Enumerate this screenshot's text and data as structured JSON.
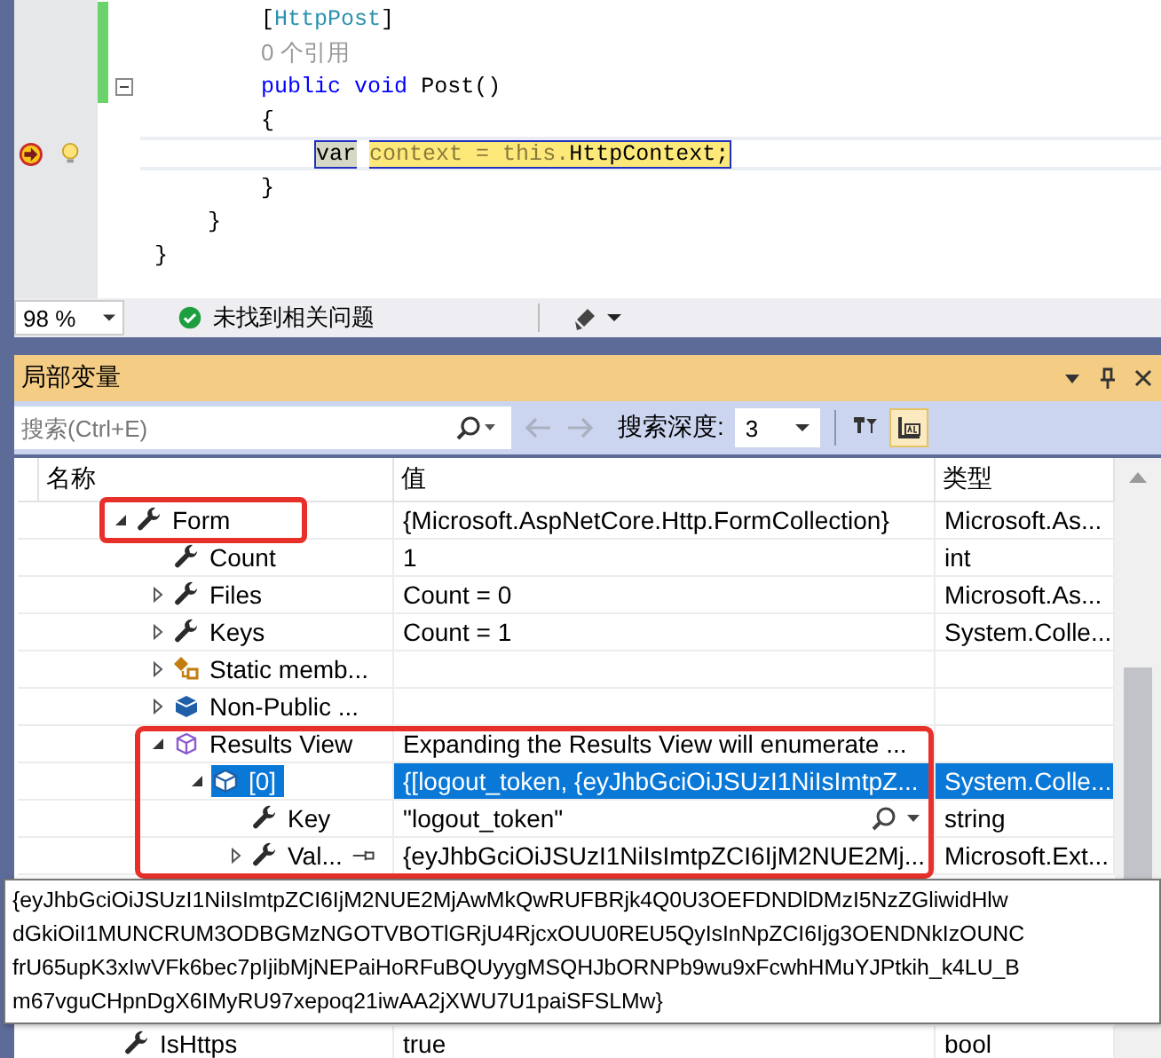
{
  "editor": {
    "lines": [
      {
        "kind": "code",
        "changed": true,
        "tokens": [
          {
            "text": "        [",
            "kind": "plain"
          },
          {
            "text": "HttpPost",
            "kind": "type"
          },
          {
            "text": "]",
            "kind": "plain"
          }
        ]
      },
      {
        "kind": "codelens",
        "changed": true,
        "text": "0 个引用"
      },
      {
        "kind": "code",
        "changed": true,
        "folded": false,
        "tokens": [
          {
            "text": "        public",
            "kind": "keyword"
          },
          {
            "text": " void",
            "kind": "keyword"
          },
          {
            "text": " Post()",
            "kind": "plain"
          }
        ]
      },
      {
        "kind": "code",
        "changed": false,
        "tokens": [
          {
            "text": "        {",
            "kind": "plain"
          }
        ]
      },
      {
        "kind": "code",
        "changed": false,
        "current": true,
        "lightbulb": true,
        "tokens": [
          {
            "text": "            var",
            "kind": "ref"
          },
          {
            "text": " context = this.",
            "kind": "faded"
          },
          {
            "text": "HttpContext;",
            "kind": "plain"
          }
        ]
      },
      {
        "kind": "code",
        "changed": false,
        "tokens": [
          {
            "text": "        }",
            "kind": "plain"
          }
        ]
      },
      {
        "kind": "code",
        "changed": false,
        "tokens": [
          {
            "text": "    }",
            "kind": "plain"
          }
        ]
      },
      {
        "kind": "code",
        "changed": false,
        "tokens": [
          {
            "text": "}",
            "kind": "plain"
          }
        ]
      }
    ]
  },
  "status_bar": {
    "zoom": "98 %",
    "issues": "未找到相关问题"
  },
  "locals": {
    "title": "局部变量",
    "search": {
      "placeholder": "搜索(Ctrl+E)"
    },
    "depth_label": "搜索深度:",
    "depth": "3",
    "toggle_selected": true,
    "columns": [
      "名称",
      "值",
      "类型"
    ],
    "rows": [
      {
        "name": "Form",
        "value": "{Microsoft.AspNetCore.Http.FormCollection}",
        "type": "Microsoft.As...",
        "kind": "property",
        "expanded": true,
        "selected": false,
        "annotated": true,
        "children": [
          {
            "name": "Count",
            "value": "1",
            "type": "int",
            "kind": "property",
            "selected": false
          },
          {
            "name": "Files",
            "value": "Count = 0",
            "type": "Microsoft.As...",
            "kind": "property",
            "expanded": false,
            "selected": false
          },
          {
            "name": "Keys",
            "value": "Count = 1",
            "type": "System.Colle...",
            "kind": "property",
            "expanded": false,
            "selected": false
          },
          {
            "name": "Static memb...",
            "kind": "static",
            "expanded": false,
            "selected": false
          },
          {
            "name": "Non-Public ...",
            "kind": "nonpublic",
            "expanded": false,
            "selected": false
          },
          {
            "name": "Results View",
            "value": "Expanding the Results View will enumerate ...",
            "kind": "results",
            "expanded": true,
            "selected": false,
            "annotated": true,
            "children": [
              {
                "name": "[0]",
                "value": "{[logout_token, {eyJhbGciOiJSUzI1NiIsImtpZ...",
                "type": "System.Colle...",
                "kind": "item",
                "expanded": true,
                "selected": true,
                "children": [
                  {
                    "name": "Key",
                    "value": "\"logout_token\"",
                    "type": "string",
                    "kind": "property",
                    "selected": false,
                    "visualizer": true
                  },
                  {
                    "name": "Val...",
                    "value": "{eyJhbGciOiJSUzI1NiIsImtpZCI6IjM2NUE2Mj...",
                    "type": "Microsoft.Ext...",
                    "kind": "property",
                    "expanded": false,
                    "selected": false,
                    "pinnable": true
                  }
                ]
              }
            ]
          }
        ]
      },
      {
        "name": "IsHttps",
        "value": "true",
        "type": "bool",
        "kind": "property",
        "selected": false
      }
    ],
    "tooltip": [
      "{eyJhbGciOiJSUzI1NiIsImtpZCI6IjM2NUE2MjAwMkQwRUFBRjk4Q0U3OEFDNDlDMzI5NzZGliwidHlw",
      "dGkiOiI1MUNCRUM3ODBGMzNGOTVBOTlGRjU4RjcxOUU0REU5QyIsInNpZCI6Ijg3OENDNkIzOUNC",
      "frU65upK3xIwVFk6bec7pIjibMjNEPaiHoRFuBQUyygMSQHJbORNPb9wu9xFcwhHMuYJPtkih_k4LU_B",
      "m67vguCHpnDgX6IMyRU97xepoq21iwAA2jXWU7U1paiSFSLMw}"
    ]
  }
}
